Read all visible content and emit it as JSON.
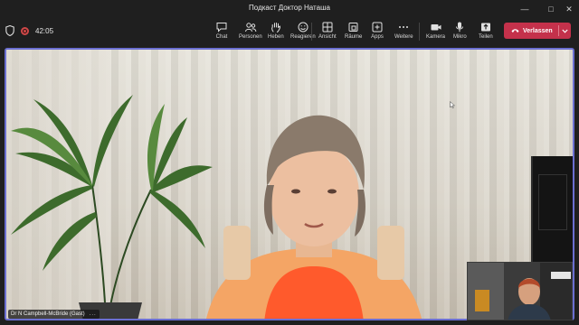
{
  "window": {
    "title": "Подкаст Доктор Наташа"
  },
  "toolbar": {
    "timer": "42:05",
    "buttons": [
      {
        "label": "Chat",
        "icon": "chat-icon"
      },
      {
        "label": "Personen",
        "icon": "people-icon"
      },
      {
        "label": "Heben",
        "icon": "raise-hand-icon"
      },
      {
        "label": "Reagieren",
        "icon": "react-icon"
      },
      {
        "label": "Ansicht",
        "icon": "view-icon"
      },
      {
        "label": "Räume",
        "icon": "rooms-icon"
      },
      {
        "label": "Apps",
        "icon": "apps-icon"
      },
      {
        "label": "Weitere",
        "icon": "more-icon"
      },
      {
        "label": "Kamera",
        "icon": "camera-icon"
      },
      {
        "label": "Mikro",
        "icon": "mic-icon"
      },
      {
        "label": "Teilen",
        "icon": "share-icon"
      }
    ],
    "leave_label": "Verlassen"
  },
  "stage": {
    "participant_name": "Dr N Campbell-McBride (Gast)",
    "more": "..."
  },
  "colors": {
    "leave": "#c4314b",
    "stage_border": "#6b6fd1"
  }
}
